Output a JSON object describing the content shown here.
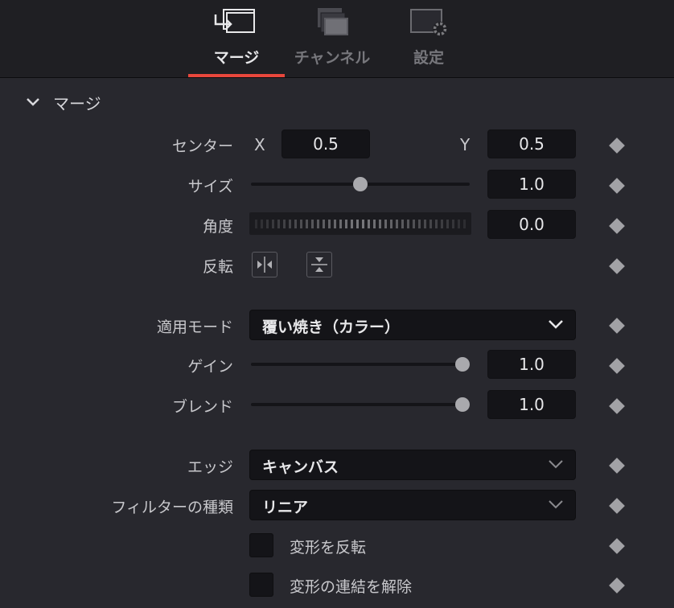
{
  "tabs": [
    {
      "label": "マージ",
      "icon": "merge-icon",
      "active": true
    },
    {
      "label": "チャンネル",
      "icon": "channel-icon",
      "active": false
    },
    {
      "label": "設定",
      "icon": "settings-icon",
      "active": false
    }
  ],
  "section": {
    "title": "マージ",
    "icon": "chevron-down-icon"
  },
  "center": {
    "label": "センター",
    "x_label": "X",
    "x_value": "0.5",
    "y_label": "Y",
    "y_value": "0.5"
  },
  "size": {
    "label": "サイズ",
    "value": "1.0",
    "slider_fraction": 0.5
  },
  "angle": {
    "label": "角度",
    "value": "0.0"
  },
  "flip": {
    "label": "反転",
    "horizontal_icon": "flip-horizontal-icon",
    "vertical_icon": "flip-vertical-icon"
  },
  "apply_mode": {
    "label": "適用モード",
    "value": "覆い焼き（カラー）"
  },
  "gain": {
    "label": "ゲイン",
    "value": "1.0",
    "slider_fraction": 1.0
  },
  "blend": {
    "label": "ブレンド",
    "value": "1.0",
    "slider_fraction": 1.0
  },
  "edge": {
    "label": "エッジ",
    "value": "キャンバス"
  },
  "filter": {
    "label": "フィルターの種類",
    "value": "リニア"
  },
  "invert_transform": {
    "label": "変形を反転",
    "checked": false
  },
  "unlink_transform": {
    "label": "変形の連結を解除",
    "checked": false
  },
  "colors": {
    "accent": "#e8473c",
    "background": "#28282e",
    "field": "#141418"
  }
}
